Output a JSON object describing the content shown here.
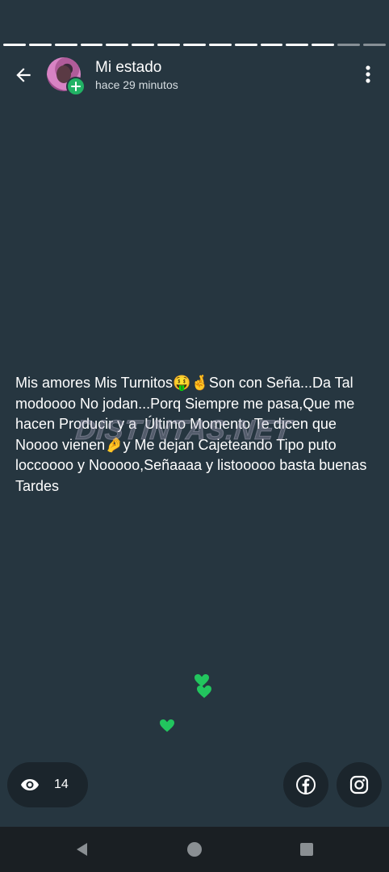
{
  "header": {
    "title": "Mi estado",
    "subtitle": "hace 29 minutos"
  },
  "progress": {
    "segments_total": 15,
    "segments_viewed": 13
  },
  "status": {
    "text": "Mis amores Mis Turnitos🤑🤞Son con Seña...Da Tal modoooo No jodan...Porq Siempre me pasa,Que me hacen Producir y a  Último Momento Te dicen que Noooo vienen🤌y Me dejan Cajeteando Tipo puto loccoooo y Nooooo,Señaaaa y listooooo basta buenas Tardes",
    "watermark": "DISTINTAS.NET",
    "background_color": "#263640"
  },
  "footer": {
    "views_count": "14",
    "icons": [
      "eye-icon",
      "facebook-icon",
      "instagram-icon"
    ]
  },
  "reactions": {
    "color": "#22c55e",
    "icons": [
      "heart-icon",
      "heart-icon",
      "heart-icon"
    ]
  },
  "colors": {
    "accent_green": "#21b264",
    "pill_background": "#1b252c",
    "nav_background": "#1a1f23"
  }
}
